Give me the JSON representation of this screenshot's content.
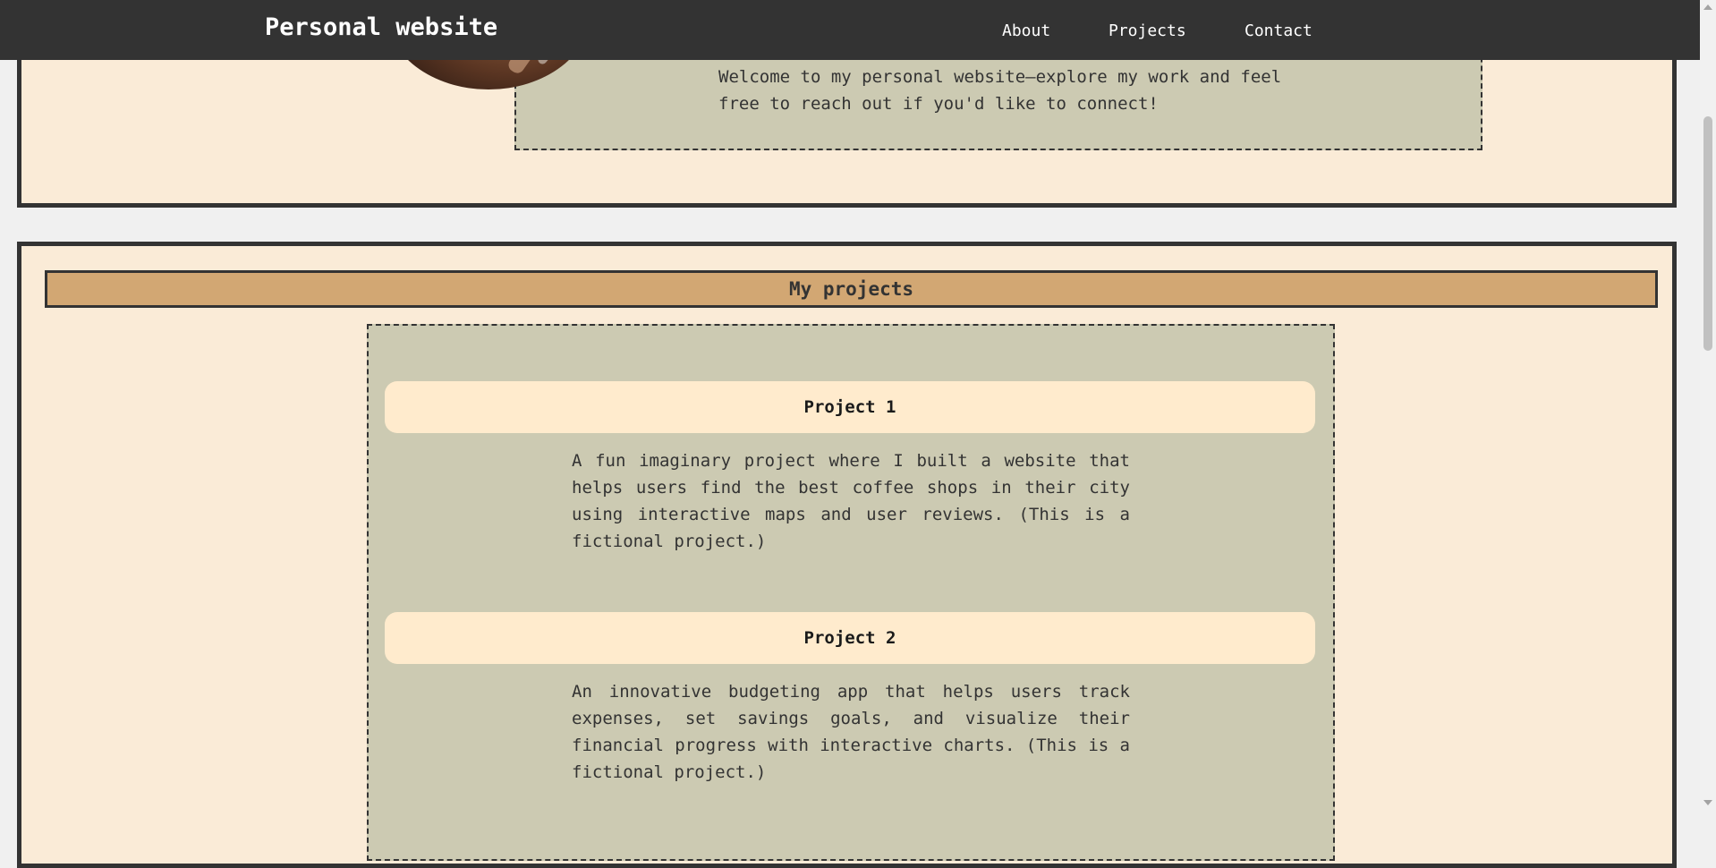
{
  "navbar": {
    "brand": "Personal website",
    "links": [
      "About",
      "Projects",
      "Contact"
    ]
  },
  "about": {
    "welcome_text": "Welcome to my personal website—explore my work and feel free to reach out if you'd like to connect!"
  },
  "projects": {
    "title": "My projects",
    "items": [
      {
        "title": "Project 1",
        "description": "A fun imaginary project where I built a website that helps users find the best coffee shops in their city using interactive maps and user reviews. (This is a fictional project.)"
      },
      {
        "title": "Project 2",
        "description": "An innovative budgeting app that helps users track expenses, set savings goals, and visualize their financial progress with interactive charts. (This is a fictional project.)"
      }
    ]
  },
  "colors": {
    "navbar_bg": "#333333",
    "section_bg": "#faebd7",
    "box_bg": "#cccab2",
    "title_bar": "#d2a773",
    "project_header_bg": "#ffebcd"
  }
}
